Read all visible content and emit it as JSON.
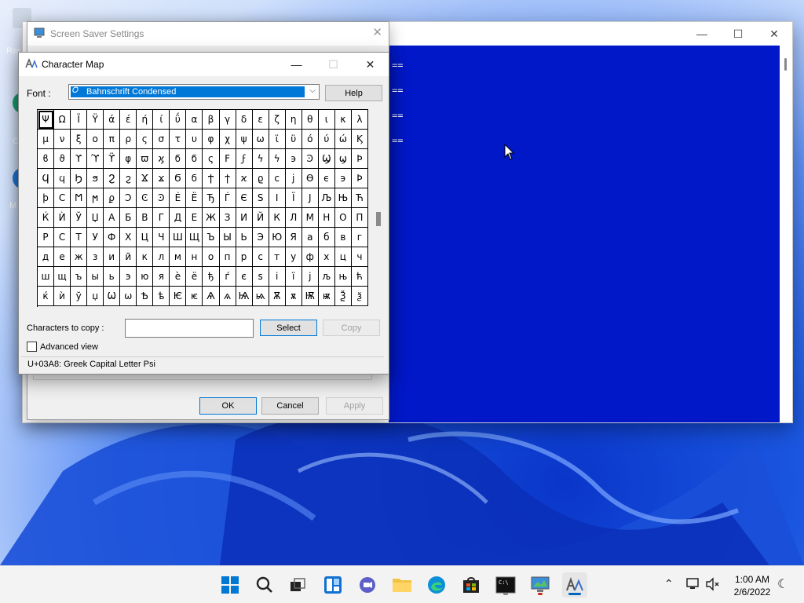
{
  "desktop": {
    "icons": [
      {
        "label": "Rec",
        "name": "recycle-bin"
      },
      {
        "label": "C",
        "name": "edge-shortcut"
      },
      {
        "label": "M",
        "name": "microsoft-shortcut"
      }
    ]
  },
  "background_window": {
    "console_lines": [
      "==",
      "==",
      "==",
      "=="
    ]
  },
  "screen_saver": {
    "title": "Screen Saver Settings",
    "buttons": {
      "ok": "OK",
      "cancel": "Cancel",
      "apply": "Apply"
    }
  },
  "char_map": {
    "title": "Character Map",
    "font_label": "Font :",
    "font_value": "Bahnschrift Condensed",
    "help_label": "Help",
    "characters_to_copy_label": "Characters to copy :",
    "characters_to_copy_value": "",
    "select_label": "Select",
    "copy_label": "Copy",
    "advanced_view_label": "Advanced view",
    "advanced_view_checked": false,
    "status": "U+03A8: Greek Capital Letter Psi",
    "grid": [
      [
        "Ψ",
        "Ω",
        "Ϊ",
        "Ϋ",
        "ά",
        "έ",
        "ή",
        "ί",
        "ΰ",
        "α",
        "β",
        "γ",
        "δ",
        "ε",
        "ζ",
        "η",
        "θ",
        "ι",
        "κ",
        "λ"
      ],
      [
        "μ",
        "ν",
        "ξ",
        "ο",
        "π",
        "ρ",
        "ς",
        "σ",
        "τ",
        "υ",
        "φ",
        "χ",
        "ψ",
        "ω",
        "ϊ",
        "ϋ",
        "ό",
        "ύ",
        "ώ",
        "Ϗ"
      ],
      [
        "ϐ",
        "ϑ",
        "ϒ",
        "ϓ",
        "ϔ",
        "φ",
        "ϖ",
        "ϗ",
        "ϭ",
        "ϭ",
        "ς",
        "Ϝ",
        "ϝ",
        "ϟ",
        "ϟ",
        "϶",
        "Ͽ",
        "Ϣ",
        "ϣ",
        "Ϸ"
      ],
      [
        "Ϥ",
        "ϥ",
        "Ϧ",
        "ϧ",
        "Ϩ",
        "ϩ",
        "Ϫ",
        "ϫ",
        "Ϭ",
        "ϭ",
        "Ϯ",
        "ϯ",
        "ϰ",
        "ϱ",
        "ϲ",
        "ϳ",
        "ϴ",
        "ϵ",
        "϶",
        "Ϸ"
      ],
      [
        "ϸ",
        "Ϲ",
        "Ϻ",
        "ϻ",
        "ϼ",
        "Ͻ",
        "Ͼ",
        "Ͽ",
        "Ѐ",
        "Ё",
        "Ђ",
        "Ѓ",
        "Є",
        "Ѕ",
        "І",
        "Ї",
        "Ј",
        "Љ",
        "Њ",
        "Ћ"
      ],
      [
        "Ќ",
        "Ѝ",
        "Ў",
        "Џ",
        "А",
        "Б",
        "В",
        "Г",
        "Д",
        "Е",
        "Ж",
        "З",
        "И",
        "Й",
        "К",
        "Л",
        "М",
        "Н",
        "О",
        "П"
      ],
      [
        "Р",
        "С",
        "Т",
        "У",
        "Ф",
        "Х",
        "Ц",
        "Ч",
        "Ш",
        "Щ",
        "Ъ",
        "Ы",
        "Ь",
        "Э",
        "Ю",
        "Я",
        "а",
        "б",
        "в",
        "г"
      ],
      [
        "д",
        "е",
        "ж",
        "з",
        "и",
        "й",
        "к",
        "л",
        "м",
        "н",
        "о",
        "п",
        "р",
        "с",
        "т",
        "у",
        "ф",
        "х",
        "ц",
        "ч"
      ],
      [
        "ш",
        "щ",
        "ъ",
        "ы",
        "ь",
        "э",
        "ю",
        "я",
        "ѐ",
        "ё",
        "ђ",
        "ѓ",
        "є",
        "ѕ",
        "і",
        "ї",
        "ј",
        "љ",
        "њ",
        "ћ"
      ],
      [
        "ќ",
        "ѝ",
        "ў",
        "џ",
        "Ѡ",
        "ѡ",
        "Ѣ",
        "ѣ",
        "Ѥ",
        "ѥ",
        "Ѧ",
        "ѧ",
        "Ѩ",
        "ѩ",
        "Ѫ",
        "ѫ",
        "Ѭ",
        "ѭ",
        "Ѯ",
        "ѯ"
      ]
    ]
  },
  "taskbar": {
    "apps": [
      {
        "name": "start-icon"
      },
      {
        "name": "search-icon"
      },
      {
        "name": "task-view-icon"
      },
      {
        "name": "widgets-icon"
      },
      {
        "name": "chat-icon"
      },
      {
        "name": "file-explorer-icon"
      },
      {
        "name": "edge-icon"
      },
      {
        "name": "store-icon"
      },
      {
        "name": "terminal-icon"
      },
      {
        "name": "screen-saver-icon"
      },
      {
        "name": "character-map-icon"
      }
    ],
    "time": "1:00 AM",
    "date": "2/6/2022"
  },
  "colors": {
    "console_bg": "#0018c8",
    "accent": "#0078d7",
    "wallpaper_blue": "#1a56e0"
  }
}
